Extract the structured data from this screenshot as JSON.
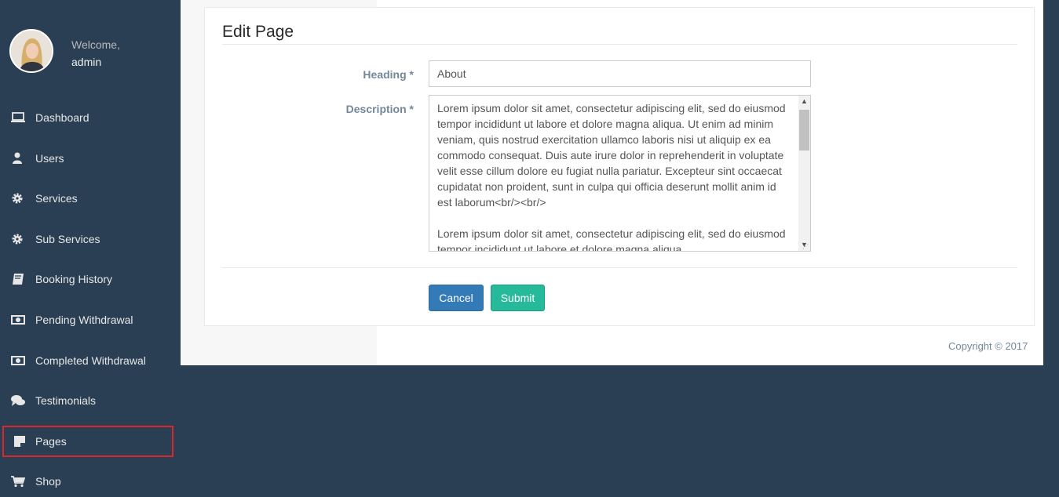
{
  "profile": {
    "welcome_text": "Welcome,",
    "username": "admin"
  },
  "sidebar": {
    "items": [
      {
        "label": "Dashboard",
        "icon": "laptop-icon"
      },
      {
        "label": "Users",
        "icon": "user-icon"
      },
      {
        "label": "Services",
        "icon": "gear-icon"
      },
      {
        "label": "Sub Services",
        "icon": "gear-icon"
      },
      {
        "label": "Booking History",
        "icon": "book-icon"
      },
      {
        "label": "Pending Withdrawal",
        "icon": "money-icon"
      },
      {
        "label": "Completed Withdrawal",
        "icon": "money-icon"
      },
      {
        "label": "Testimonials",
        "icon": "comments-icon"
      },
      {
        "label": "Pages",
        "icon": "sticky-note-icon"
      },
      {
        "label": "Shop",
        "icon": "cart-icon"
      }
    ]
  },
  "page": {
    "title": "Edit Page"
  },
  "form": {
    "heading_label": "Heading *",
    "heading_value": "About",
    "description_label": "Description *",
    "description_value": "Lorem ipsum dolor sit amet, consectetur adipiscing elit, sed do eiusmod tempor incididunt ut labore et dolore magna aliqua. Ut enim ad minim veniam, quis nostrud exercitation ullamco laboris nisi ut aliquip ex ea commodo consequat. Duis aute irure dolor in reprehenderit in voluptate velit esse cillum dolore eu fugiat nulla pariatur. Excepteur sint occaecat cupidatat non proident, sunt in culpa qui officia deserunt mollit anim id est laborum<br/><br/>\n\nLorem ipsum dolor sit amet, consectetur adipiscing elit, sed do eiusmod tempor incididunt ut labore et dolore magna aliqua.",
    "cancel_label": "Cancel",
    "submit_label": "Submit"
  },
  "footer": {
    "copyright": "Copyright © 2017"
  },
  "colors": {
    "sidebar_bg": "#2a3f54",
    "primary": "#337ab7",
    "success": "#26b99a",
    "highlight_border": "#d9272e"
  }
}
